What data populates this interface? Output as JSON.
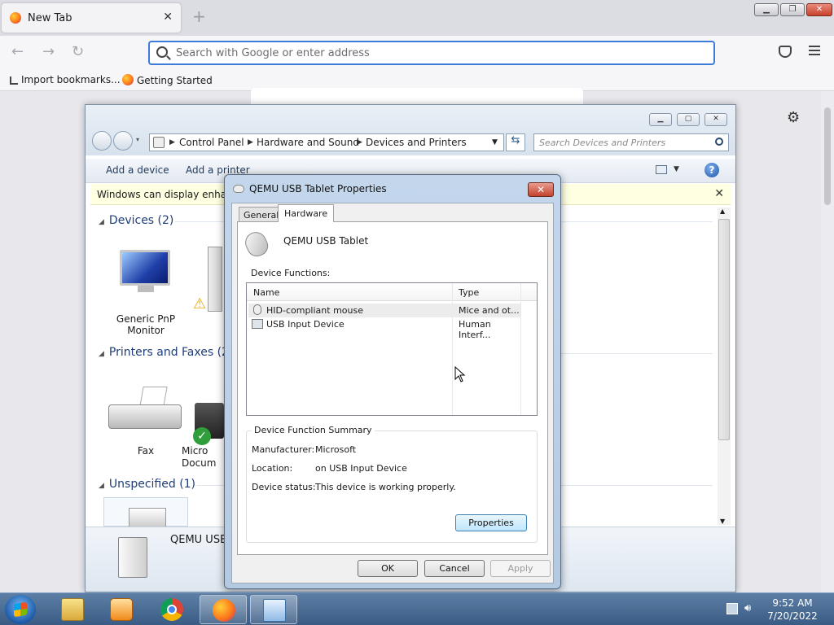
{
  "browser": {
    "tab_title": "New Tab",
    "url_placeholder": "Search with Google or enter address",
    "bookmarks": [
      "Import bookmarks...",
      "Getting Started"
    ]
  },
  "explorer": {
    "breadcrumb": [
      "Control Panel",
      "Hardware and Sound",
      "Devices and Printers"
    ],
    "search_placeholder": "Search Devices and Printers",
    "commands": [
      "Add a device",
      "Add a printer"
    ],
    "infobar_text": "Windows can display enhanc",
    "groups": [
      {
        "label": "Devices (2)"
      },
      {
        "label": "Printers and Faxes (2)"
      },
      {
        "label": "Unspecified (1)"
      }
    ],
    "devices": [
      "Generic PnP Monitor"
    ],
    "printers": [
      "Fax",
      "Micro Docum"
    ],
    "detail_name": "QEMU USB"
  },
  "dialog": {
    "title": "QEMU USB Tablet Properties",
    "tabs": [
      "General",
      "Hardware"
    ],
    "device_name": "QEMU USB Tablet",
    "functions_label": "Device Functions:",
    "columns": [
      "Name",
      "Type"
    ],
    "rows": [
      {
        "name": "HID-compliant mouse",
        "type": "Mice and ot..."
      },
      {
        "name": "USB Input Device",
        "type": "Human Interf..."
      }
    ],
    "summary_label": "Device Function Summary",
    "summary": [
      {
        "key": "Manufacturer:",
        "value": "Microsoft"
      },
      {
        "key": "Location:",
        "value": "on USB Input Device"
      },
      {
        "key": "Device status:",
        "value": "This device is working properly."
      }
    ],
    "properties_button": "Properties",
    "ok": "OK",
    "cancel": "Cancel",
    "apply": "Apply"
  },
  "taskbar": {
    "time": "9:52 AM",
    "date": "7/20/2022"
  }
}
